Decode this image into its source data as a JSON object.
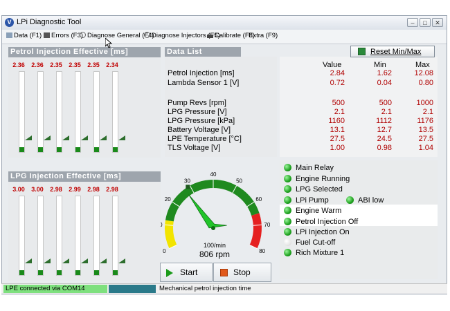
{
  "window": {
    "title": "LPi Diagnostic Tool",
    "app_icon_letter": "V",
    "controls": {
      "minimize": "–",
      "maximize": "□",
      "close": "✕"
    }
  },
  "menu": {
    "items": [
      {
        "label": "Data (F1)",
        "icon": "data-icon"
      },
      {
        "label": "Errors (F3)",
        "icon": "errors-icon"
      },
      {
        "label": "Diagnose General (F4)",
        "icon": "stethoscope-icon"
      },
      {
        "label": "Diagnose Injectors (F5)",
        "icon": "stethoscope-icon"
      },
      {
        "label": "Calibrate (F8)",
        "icon": "calibrate-icon"
      },
      {
        "label": "Extra (F9)",
        "icon": ""
      }
    ]
  },
  "petrol_injection": {
    "title": "Petrol Injection Effective [ms]",
    "values": [
      "2.36",
      "2.36",
      "2.35",
      "2.35",
      "2.35",
      "2.34"
    ],
    "fill_levels": [
      0.06,
      0.06,
      0.06,
      0.06,
      0.06,
      0.06
    ]
  },
  "lpg_injection": {
    "title": "LPG Injection Effective [ms]",
    "values": [
      "3.00",
      "3.00",
      "2.98",
      "2.99",
      "2.98",
      "2.98"
    ],
    "fill_levels": [
      0.06,
      0.06,
      0.06,
      0.06,
      0.06,
      0.06
    ]
  },
  "data_list": {
    "title": "Data List",
    "rows": [
      "Petrol Injection [ms]",
      "Lambda Sensor 1 [V]",
      "Pump Revs [rpm]",
      "LPG Pressure [V]",
      "LPG Pressure [kPa]",
      "Battery Voltage [V]",
      "LPE Temperature [°C]",
      "TLS Voltage [V]"
    ]
  },
  "values_panel": {
    "reset_label": "Reset Min/Max",
    "headers": {
      "value": "Value",
      "min": "Min",
      "max": "Max"
    },
    "rows": [
      {
        "value": "2.84",
        "min": "1.62",
        "max": "12.08"
      },
      {
        "value": "0.72",
        "min": "0.04",
        "max": "0.80"
      },
      {
        "value": "500",
        "min": "500",
        "max": "1000"
      },
      {
        "value": "2.1",
        "min": "2.1",
        "max": "2.1"
      },
      {
        "value": "1160",
        "min": "1112",
        "max": "1176"
      },
      {
        "value": "13.1",
        "min": "12.7",
        "max": "13.5"
      },
      {
        "value": "27.5",
        "min": "24.5",
        "max": "27.5"
      },
      {
        "value": "1.00",
        "min": "0.98",
        "max": "1.04"
      }
    ]
  },
  "gauge": {
    "unit": "100/min",
    "readout": "806 rpm",
    "rpm_value": 806,
    "ticks": [
      "0",
      "10",
      "20",
      "30",
      "40",
      "50",
      "60",
      "70",
      "80"
    ],
    "colors": {
      "green": "#1f8a1f",
      "yellow": "#f2e400",
      "red": "#e52020",
      "needle": "#22c42a"
    }
  },
  "buttons": {
    "start": "Start",
    "stop": "Stop"
  },
  "status": {
    "items": [
      {
        "label": "Main Relay",
        "on": true
      },
      {
        "label": "Engine Running",
        "on": true
      },
      {
        "label": "LPG Selected",
        "on": true
      },
      {
        "label": "LPi Pump",
        "on": true
      },
      {
        "label": "Engine Warm",
        "on": true
      },
      {
        "label": "Petrol Injection Off",
        "on": true
      },
      {
        "label": "LPi Injection On",
        "on": true
      },
      {
        "label": "Fuel Cut-off",
        "on": false
      },
      {
        "label": "Rich Mixture 1",
        "on": true
      }
    ],
    "abi": {
      "label": "ABI low",
      "on": true
    }
  },
  "statusbar": {
    "connection": "LPE connected via COM14",
    "message": "Mechanical petrol injection time"
  }
}
